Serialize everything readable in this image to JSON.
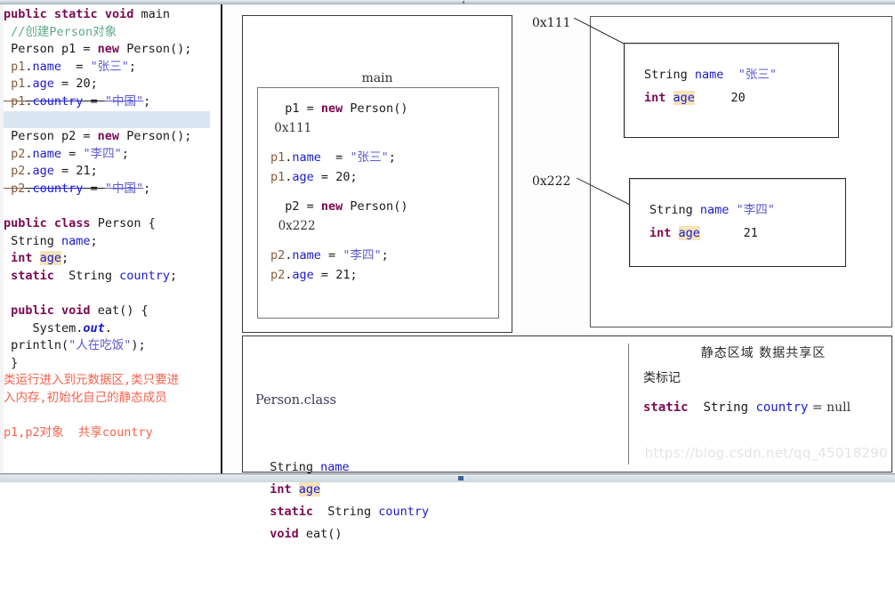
{
  "editor": {
    "left_code_lines": [
      [
        {
          "t": "public ",
          "c": "kw"
        },
        {
          "t": "static ",
          "c": "kw"
        },
        {
          "t": "void ",
          "c": "kw"
        },
        {
          "t": "main",
          "c": "plain"
        }
      ],
      [
        {
          "t": " //创建Person对象",
          "c": "cmt"
        }
      ],
      [
        {
          "t": " Person p1 = ",
          "c": "plain"
        },
        {
          "t": "new ",
          "c": "kw"
        },
        {
          "t": "Person();",
          "c": "plain"
        }
      ],
      [
        {
          "t": " p1",
          "c": "var"
        },
        {
          "t": ".",
          "c": "plain"
        },
        {
          "t": "name",
          "c": "fld"
        },
        {
          "t": "  = ",
          "c": "plain"
        },
        {
          "t": "\"张三\"",
          "c": "str"
        },
        {
          "t": ";",
          "c": "plain"
        }
      ],
      [
        {
          "t": " p1",
          "c": "var"
        },
        {
          "t": ".",
          "c": "plain"
        },
        {
          "t": "age",
          "c": "fld"
        },
        {
          "t": " = ",
          "c": "plain"
        },
        {
          "t": "20;",
          "c": "plain"
        }
      ],
      [
        {
          "t": " p1",
          "c": "var strike"
        },
        {
          "t": ".",
          "c": "plain strike"
        },
        {
          "t": "country",
          "c": "fld strike"
        },
        {
          "t": " = ",
          "c": "plain strike"
        },
        {
          "t": "\"中国\"",
          "c": "str strike"
        },
        {
          "t": ";",
          "c": "plain"
        }
      ],
      [
        {
          "t": "",
          "c": "plain"
        }
      ],
      [
        {
          "t": " Person p2 = ",
          "c": "plain"
        },
        {
          "t": "new ",
          "c": "kw"
        },
        {
          "t": "Person();",
          "c": "plain"
        }
      ],
      [
        {
          "t": " p2",
          "c": "var"
        },
        {
          "t": ".",
          "c": "plain"
        },
        {
          "t": "name",
          "c": "fld"
        },
        {
          "t": " = ",
          "c": "plain"
        },
        {
          "t": "\"李四\"",
          "c": "str"
        },
        {
          "t": ";",
          "c": "plain"
        }
      ],
      [
        {
          "t": " p2",
          "c": "var"
        },
        {
          "t": ".",
          "c": "plain"
        },
        {
          "t": "age",
          "c": "fld"
        },
        {
          "t": " = ",
          "c": "plain"
        },
        {
          "t": "21;",
          "c": "plain"
        }
      ],
      [
        {
          "t": " p2",
          "c": "var strike"
        },
        {
          "t": ".",
          "c": "plain strike"
        },
        {
          "t": "country",
          "c": "fld strike"
        },
        {
          "t": " = ",
          "c": "plain strike"
        },
        {
          "t": "\"中国\"",
          "c": "str strike"
        },
        {
          "t": ";",
          "c": "plain"
        }
      ],
      [
        {
          "t": "",
          "c": "plain"
        }
      ],
      [
        {
          "t": "public ",
          "c": "kw"
        },
        {
          "t": "class ",
          "c": "kw"
        },
        {
          "t": "Person {",
          "c": "plain"
        }
      ],
      [
        {
          "t": " String ",
          "c": "plain"
        },
        {
          "t": "name",
          "c": "fld"
        },
        {
          "t": ";",
          "c": "plain"
        }
      ],
      [
        {
          "t": " ",
          "c": "plain"
        },
        {
          "t": "int ",
          "c": "kw"
        },
        {
          "t": "age",
          "c": "hlage"
        },
        {
          "t": ";",
          "c": "plain"
        }
      ],
      [
        {
          "t": " ",
          "c": "plain"
        },
        {
          "t": "static ",
          "c": "kw"
        },
        {
          "t": " String ",
          "c": "plain"
        },
        {
          "t": "country",
          "c": "fld"
        },
        {
          "t": ";",
          "c": "plain"
        }
      ],
      [
        {
          "t": "",
          "c": "plain"
        }
      ],
      [
        {
          "t": " ",
          "c": "plain"
        },
        {
          "t": "public ",
          "c": "kw"
        },
        {
          "t": "void ",
          "c": "kw"
        },
        {
          "t": "eat() {",
          "c": "plain"
        }
      ],
      [
        {
          "t": "    System.",
          "c": "plain"
        },
        {
          "t": "out",
          "c": "italic"
        },
        {
          "t": ".",
          "c": "plain"
        }
      ],
      [
        {
          "t": " println(",
          "c": "plain"
        },
        {
          "t": "\"人在吃饭\"",
          "c": "str"
        },
        {
          "t": ");",
          "c": "plain"
        }
      ],
      [
        {
          "t": " }",
          "c": "plain"
        }
      ],
      [
        {
          "t": "类运行进入到元数据区,类只要进",
          "c": "red"
        }
      ],
      [
        {
          "t": "入内存,初始化自己的静态成员",
          "c": "red"
        }
      ],
      [
        {
          "t": "",
          "c": "plain"
        }
      ],
      [
        {
          "t": "p1,p2对象  共享country",
          "c": "red"
        }
      ]
    ],
    "highlighted_line_index": 6
  },
  "stack": {
    "title": "main",
    "lines": [
      [
        {
          "t": "  p1 = ",
          "c": "plain"
        },
        {
          "t": "new ",
          "c": "kw"
        },
        {
          "t": "Person()",
          "c": "plain"
        }
      ],
      [
        {
          "t": " 0x111",
          "c": "serif"
        }
      ],
      [
        {
          "t": "",
          "c": "gapline"
        }
      ],
      [
        {
          "t": "p1",
          "c": "var"
        },
        {
          "t": ".",
          "c": "plain"
        },
        {
          "t": "name",
          "c": "fld"
        },
        {
          "t": "  = ",
          "c": "plain"
        },
        {
          "t": "\"张三\"",
          "c": "str"
        },
        {
          "t": ";",
          "c": "plain"
        }
      ],
      [
        {
          "t": "p1",
          "c": "var"
        },
        {
          "t": ".",
          "c": "plain"
        },
        {
          "t": "age",
          "c": "fld"
        },
        {
          "t": " = ",
          "c": "plain"
        },
        {
          "t": "20;",
          "c": "plain"
        }
      ],
      [
        {
          "t": "",
          "c": "gapline"
        }
      ],
      [
        {
          "t": "  p2 = ",
          "c": "plain"
        },
        {
          "t": "new ",
          "c": "kw"
        },
        {
          "t": "Person()",
          "c": "plain"
        }
      ],
      [
        {
          "t": "  0x222",
          "c": "serif"
        }
      ],
      [
        {
          "t": "",
          "c": "gapline"
        }
      ],
      [
        {
          "t": "p2",
          "c": "var"
        },
        {
          "t": ".",
          "c": "plain"
        },
        {
          "t": "name",
          "c": "fld"
        },
        {
          "t": " = ",
          "c": "plain"
        },
        {
          "t": "\"李四\"",
          "c": "str"
        },
        {
          "t": ";",
          "c": "plain"
        }
      ],
      [
        {
          "t": "p2",
          "c": "var"
        },
        {
          "t": ".",
          "c": "plain"
        },
        {
          "t": "age",
          "c": "fld"
        },
        {
          "t": " = ",
          "c": "plain"
        },
        {
          "t": "21;",
          "c": "plain"
        }
      ]
    ]
  },
  "heap": {
    "objects": [
      {
        "address_label": "0x111",
        "lines": [
          [
            {
              "t": "String ",
              "c": "plain"
            },
            {
              "t": "name",
              "c": "fld"
            },
            {
              "t": "  ",
              "c": "plain"
            },
            {
              "t": "\"张三\"",
              "c": "str"
            }
          ],
          [
            {
              "t": "int ",
              "c": "kw"
            },
            {
              "t": "age",
              "c": "hlage"
            },
            {
              "t": "     20",
              "c": "plain"
            }
          ]
        ]
      },
      {
        "address_label": "0x222",
        "lines": [
          [
            {
              "t": "String ",
              "c": "plain"
            },
            {
              "t": "name",
              "c": "fld"
            },
            {
              "t": " ",
              "c": "plain"
            },
            {
              "t": "\"李四\"",
              "c": "str"
            }
          ],
          [
            {
              "t": "int ",
              "c": "kw"
            },
            {
              "t": "age",
              "c": "hlage"
            },
            {
              "t": "      21",
              "c": "plain"
            }
          ]
        ]
      }
    ]
  },
  "method_area": {
    "class_title": "Person.class",
    "member_lines": [
      [
        {
          "t": "  String ",
          "c": "plain"
        },
        {
          "t": "name",
          "c": "fld"
        }
      ],
      [
        {
          "t": "  ",
          "c": "plain"
        },
        {
          "t": "int ",
          "c": "kw"
        },
        {
          "t": "age",
          "c": "hlage"
        }
      ],
      [
        {
          "t": "  ",
          "c": "plain"
        },
        {
          "t": "static ",
          "c": "kw"
        },
        {
          "t": " String ",
          "c": "plain"
        },
        {
          "t": "country",
          "c": "fld"
        }
      ],
      [
        {
          "t": "  ",
          "c": "plain"
        },
        {
          "t": "void ",
          "c": "kw"
        },
        {
          "t": "eat()",
          "c": "plain"
        }
      ]
    ],
    "static_area_header": "静态区域 数据共享区",
    "class_tag_label": "类标记",
    "static_field_line": [
      {
        "t": "static ",
        "c": "kw"
      },
      {
        "t": " String ",
        "c": "plain"
      },
      {
        "t": "country",
        "c": "fld"
      },
      {
        "t": " = ",
        "c": "serif"
      },
      {
        "t": "null",
        "c": "serif"
      }
    ],
    "watermark": "https://blog.csdn.net/qq_45018290"
  },
  "colors": {
    "keyword": "#7c0a52",
    "field": "#1a1ad0",
    "string": "#5a5ad0",
    "variable": "#8a5a3c",
    "comment": "#5fa88a",
    "annotation_red": "#f4634f",
    "age_highlight": "#f6e3b8",
    "selection_highlight": "#dbe6f2"
  }
}
